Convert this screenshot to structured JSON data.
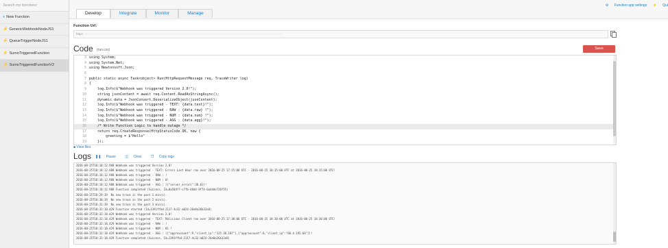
{
  "sidebar": {
    "search_placeholder": "Search my functions",
    "new_function_label": "New Function",
    "items": [
      {
        "label": "GenericWebhookNodeJS1"
      },
      {
        "label": "QueueTriggerNodeJS1"
      },
      {
        "label": "SumoTriggeredFunction"
      },
      {
        "label": "SumoTriggeredFunctionV2"
      }
    ],
    "selected_index": 3
  },
  "tabs": [
    "Develop",
    "Integrate",
    "Monitor",
    "Manage"
  ],
  "active_tab": "Develop",
  "topbar": {
    "settings_link": "Function app settings",
    "quickstart_link": "Qui"
  },
  "url_section": {
    "label": "Function Url:",
    "value_prefix": "https"
  },
  "code_section": {
    "title": "Code",
    "filename": "(run.csx)",
    "save_label": "Save",
    "view_files_label": "View files"
  },
  "code_lines": [
    {
      "num": "3",
      "text": "using System;"
    },
    {
      "num": "4",
      "text": "using System.Net;"
    },
    {
      "num": "5",
      "text": "using Newtonsoft.Json;"
    },
    {
      "num": "6",
      "text": ""
    },
    {
      "num": "7",
      "text": "public static async Task<object> Run(HttpRequestMessage req, TraceWriter log)"
    },
    {
      "num": "8",
      "text": "{"
    },
    {
      "num": "9",
      "text": "    log.Info($\"Webhook was triggered Version 2.0!\");"
    },
    {
      "num": "10",
      "text": "    string jsonContent = await req.Content.ReadAsStringAsync();"
    },
    {
      "num": "11",
      "text": "    dynamic data = JsonConvert.DeserializeObject(jsonContent);"
    },
    {
      "num": "12",
      "text": "    log.Info($\"Webhook was triggered - TEXT: {data.text}!\");"
    },
    {
      "num": "13",
      "text": "    log.Info($\"Webhook was triggered - RAW : {data.raw} !\");"
    },
    {
      "num": "14",
      "text": "    log.Info($\"Webhook was triggered - NUM : {data.num} !\");"
    },
    {
      "num": "15",
      "text": "    log.Info($\"Webhook was triggered - AGG : {data.agg}!\");"
    },
    {
      "num": "16",
      "text": "    /* Write Function Logic to handle outage */"
    },
    {
      "num": "17",
      "text": "    return req.CreateResponse(HttpStatusCode.OK, new {"
    },
    {
      "num": "18",
      "text": "        greeting = $\"Hello\""
    },
    {
      "num": "19",
      "text": "    });"
    }
  ],
  "highlight_line": "16",
  "logs_section": {
    "title": "Logs",
    "pause_label": "Pause",
    "clear_label": "Clear",
    "copy_label": "Copy logs"
  },
  "log_lines": [
    "2016-08-25T18:18:12.988 Webhook was triggered Version 2.0!",
    "2016-08-25T18:18:12.988 Webhook was triggered - TEXT: Errors Last Hour ran over 2016-08-25 17:15:00 UTC - 2016-08-25 18:15:00 UTC at 2016-08-25 18:15:00 UTC!",
    "2016-08-25T18:18:12.988 Webhook was triggered - RAW : !",
    "2016-08-25T18:18:12.988 Webhook was triggered - NUM : 0!",
    "2016-08-25T18:18:12.988 Webhook was triggered - AGG : [{\"server_errors\":30.0}]!",
    "2016-08-25T18:18:12.988 Function completed (Success, Id=0a584f7-c7fb-48d4-9f74-6a44de726f55)",
    "2016-08-25T18:29:39  No new trace in the past 1 min(s).",
    "2016-08-25T18:30:39  No new trace in the past 2 min(s).",
    "2016-08-25T18:31:39  No new trace in the past 3 min(s).",
    "2016-08-25T18:32:18.429 Function started (Id=1391ffbd-2117-4c32-a024-26e0a26b32e8)",
    "2016-08-25T18:32:18.429 Webhook was triggered Version 2.0!",
    "2016-08-25T18:32:18.429 Webhook was triggered - TEXT: Malicious Client ran over 2016-08-25 17:30:00 UTC - 2016-08-25 18:30:00 UTC at 2016-08-25 18:30:00 UTC!",
    "2016-08-25T18:32:18.429 Webhook was triggered - RAW : !",
    "2016-08-25T18:32:18.429 Webhook was triggered - NUM : 81 !",
    "2016-08-25T18:32:18.429 Webhook was triggered - AGG : [{\"approxcount\":9,\"client_ip\":\"125.36.187\"},{\"approxcount\":8,\"client_ip\":\"60.4.192.66\"}]!",
    "2016-08-25T18:32:18.429 Function completed (Success, Id=1391ffbd-2117-4c32-a024-26e0a26b32e8)"
  ],
  "colors": {
    "accent": "#1e7fc8",
    "save_button": "#d9534f",
    "function_icon": "#e0a800"
  }
}
